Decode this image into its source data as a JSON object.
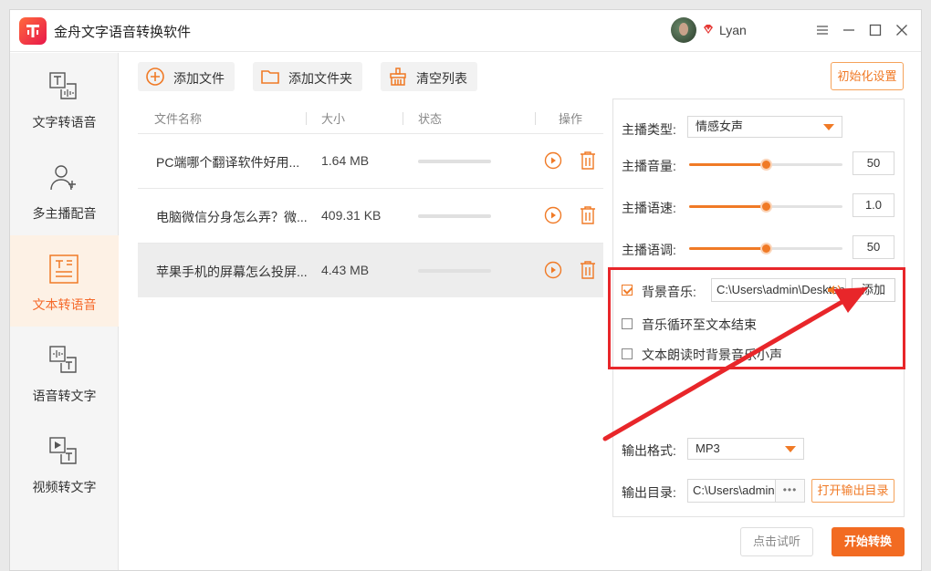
{
  "window": {
    "title": "金舟文字语音转换软件",
    "username": "Lyan"
  },
  "sidebar": {
    "items": [
      {
        "label": "文字转语音",
        "icon": "text-to-speech-icon"
      },
      {
        "label": "多主播配音",
        "icon": "multi-speaker-icon"
      },
      {
        "label": "文本转语音",
        "icon": "document-to-speech-icon",
        "active": true
      },
      {
        "label": "语音转文字",
        "icon": "speech-to-text-icon"
      },
      {
        "label": "视频转文字",
        "icon": "video-to-text-icon"
      }
    ]
  },
  "toolbar": {
    "add_file": "添加文件",
    "add_folder": "添加文件夹",
    "clear_list": "清空列表",
    "reset": "初始化设置"
  },
  "table": {
    "headers": {
      "name": "文件名称",
      "size": "大小",
      "status": "状态",
      "actions": "操作"
    },
    "rows": [
      {
        "name": "PC端哪个翻译软件好用...",
        "size": "1.64 MB",
        "progress": 0
      },
      {
        "name": "电脑微信分身怎么弄？微...",
        "size": "409.31 KB",
        "progress": 0
      },
      {
        "name": "苹果手机的屏幕怎么投屏...",
        "size": "4.43 MB",
        "progress": 0,
        "selected": true
      }
    ]
  },
  "settings": {
    "anchor_type_label": "主播类型:",
    "anchor_type_value": "情感女声",
    "volume_label": "主播音量:",
    "volume_value": "50",
    "volume_fraction": 0.5,
    "speed_label": "主播语速:",
    "speed_value": "1.0",
    "speed_fraction": 0.5,
    "pitch_label": "主播语调:",
    "pitch_value": "50",
    "pitch_fraction": 0.5,
    "bgm_label": "背景音乐:",
    "bgm_checked": true,
    "bgm_path": "C:\\Users\\admin\\Desktop",
    "bgm_add": "添加",
    "loop_label": "音乐循环至文本结束",
    "loop_checked": false,
    "duck_label": "文本朗读时背景音乐小声",
    "duck_checked": false,
    "format_label": "输出格式:",
    "format_value": "MP3",
    "dir_label": "输出目录:",
    "dir_value": "C:\\Users\\admin",
    "dir_more": "•••",
    "open_dir": "打开输出目录"
  },
  "footer": {
    "listen": "点击试听",
    "convert": "开始转换"
  },
  "colors": {
    "accent": "#f07a26",
    "annotation": "#e8262a"
  }
}
